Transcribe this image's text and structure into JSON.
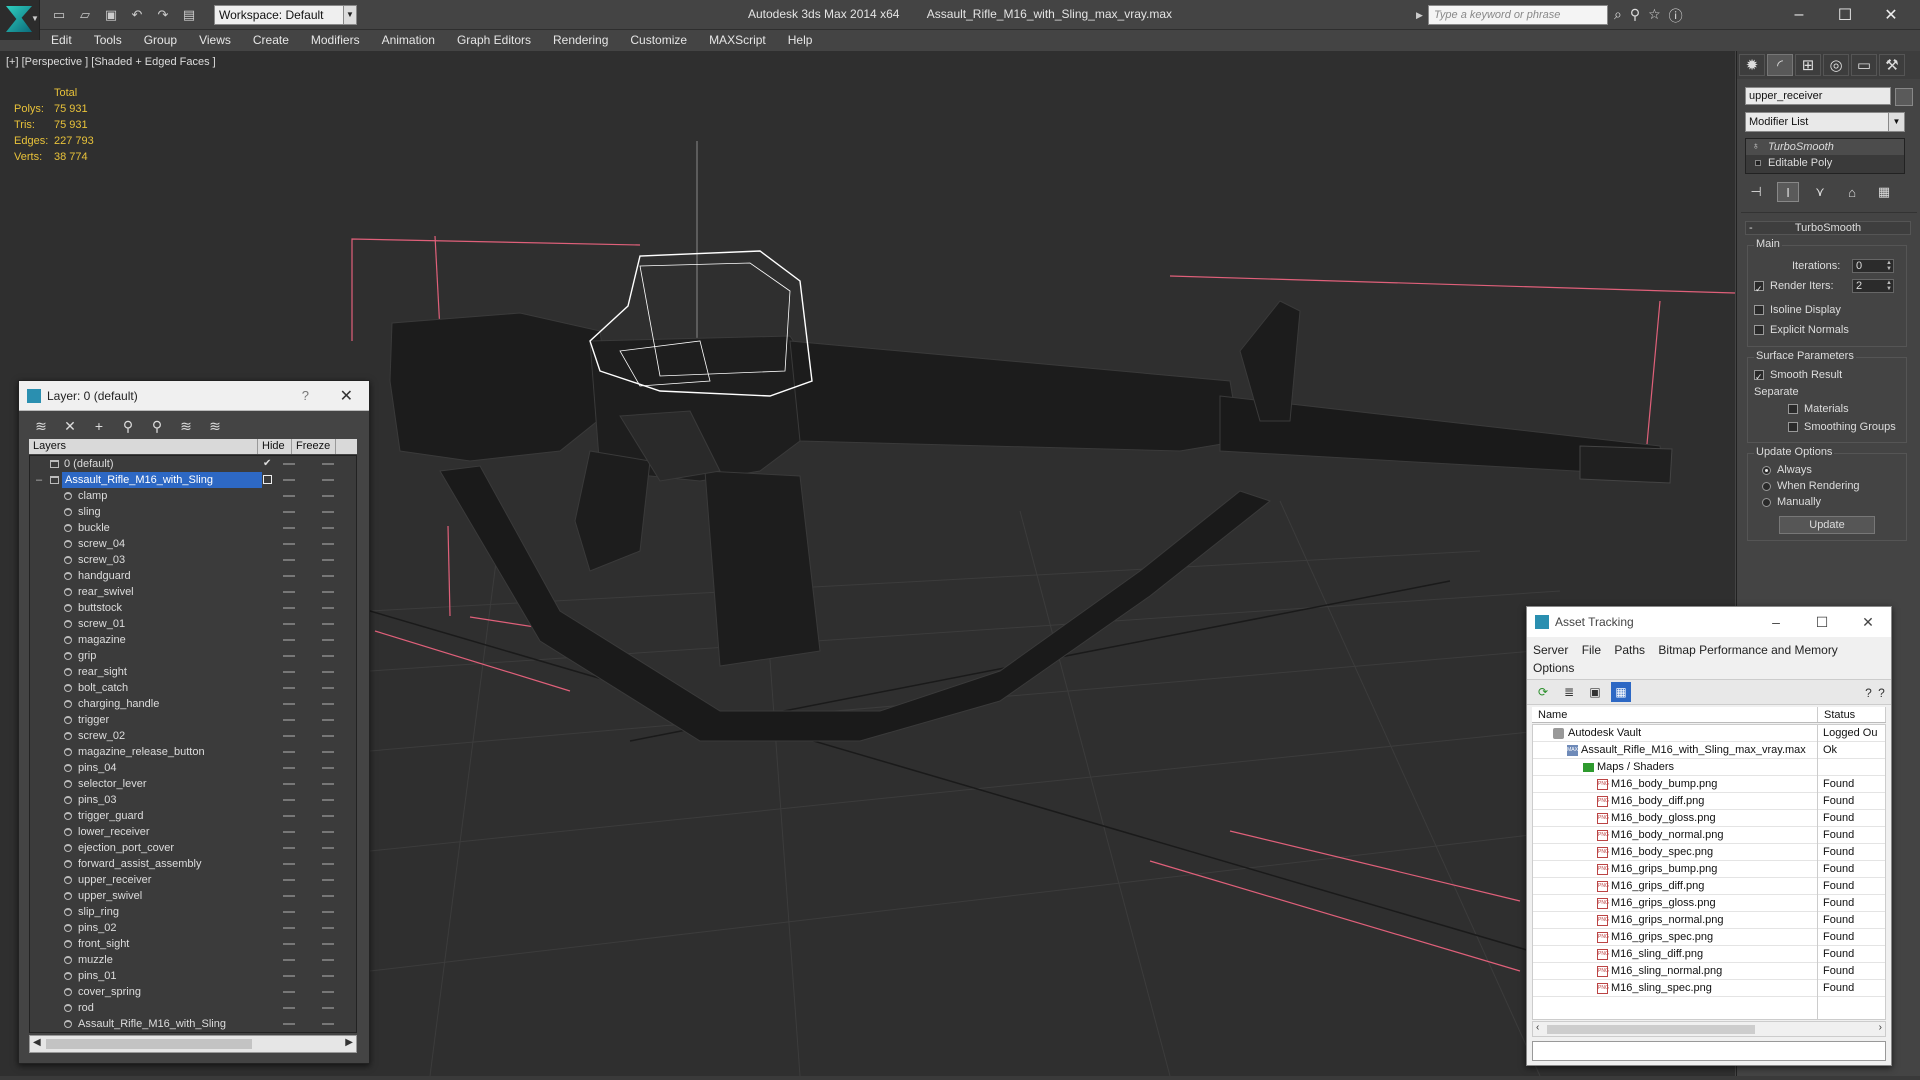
{
  "app": {
    "title": "Autodesk 3ds Max  2014 x64",
    "file": "Assault_Rifle_M16_with_Sling_max_vray.max",
    "workspace": "Workspace: Default",
    "search_placeholder": "Type a keyword or phrase"
  },
  "menu": [
    "Edit",
    "Tools",
    "Group",
    "Views",
    "Create",
    "Modifiers",
    "Animation",
    "Graph Editors",
    "Rendering",
    "Customize",
    "MAXScript",
    "Help"
  ],
  "viewport": {
    "label": "[+] [Perspective ] [Shaded + Edged Faces ]",
    "stats": {
      "header": "Total",
      "rows": [
        {
          "label": "Polys:",
          "value": "75 931"
        },
        {
          "label": "Tris:",
          "value": "75 931"
        },
        {
          "label": "Edges:",
          "value": "227 793"
        },
        {
          "label": "Verts:",
          "value": "38 774"
        }
      ]
    }
  },
  "command_panel": {
    "object_name": "upper_receiver",
    "modifier_list": "Modifier List",
    "stack": [
      "TurboSmooth",
      "Editable Poly"
    ],
    "rollout_title": "TurboSmooth",
    "main_group": "Main",
    "iterations_label": "Iterations:",
    "iterations_value": "0",
    "render_iters_label": "Render Iters:",
    "render_iters_value": "2",
    "isoline": "Isoline Display",
    "explicit_normals": "Explicit Normals",
    "surface_group": "Surface Parameters",
    "smooth_result": "Smooth Result",
    "separate": "Separate",
    "materials": "Materials",
    "smoothing_groups": "Smoothing Groups",
    "update_group": "Update Options",
    "always": "Always",
    "when_rendering": "When Rendering",
    "manually": "Manually",
    "update_button": "Update"
  },
  "layer_window": {
    "title": "Layer: 0 (default)",
    "help": "?",
    "col_layers": "Layers",
    "col_hide": "Hide",
    "col_freeze": "Freeze",
    "default_layer": "0 (default)",
    "selected_layer": "Assault_Rifle_M16_with_Sling",
    "objects": [
      "clamp",
      "sling",
      "buckle",
      "screw_04",
      "screw_03",
      "handguard",
      "rear_swivel",
      "buttstock",
      "screw_01",
      "magazine",
      "grip",
      "rear_sight",
      "bolt_catch",
      "charging_handle",
      "trigger",
      "screw_02",
      "magazine_release_button",
      "pins_04",
      "selector_lever",
      "pins_03",
      "trigger_guard",
      "lower_receiver",
      "ejection_port_cover",
      "forward_assist_assembly",
      "upper_receiver",
      "upper_swivel",
      "slip_ring",
      "pins_02",
      "front_sight",
      "muzzle",
      "pins_01",
      "cover_spring",
      "rod",
      "Assault_Rifle_M16_with_Sling"
    ]
  },
  "asset_window": {
    "title": "Asset Tracking",
    "menu": [
      "Server",
      "File",
      "Paths",
      "Bitmap Performance and Memory",
      "Options"
    ],
    "col_name": "Name",
    "col_status": "Status",
    "vault": {
      "name": "Autodesk Vault",
      "status": "Logged Ou"
    },
    "scene": {
      "name": "Assault_Rifle_M16_with_Sling_max_vray.max",
      "status": "Ok"
    },
    "maps": {
      "name": "Maps / Shaders",
      "status": ""
    },
    "files": [
      {
        "name": "M16_body_bump.png",
        "status": "Found"
      },
      {
        "name": "M16_body_diff.png",
        "status": "Found"
      },
      {
        "name": "M16_body_gloss.png",
        "status": "Found"
      },
      {
        "name": "M16_body_normal.png",
        "status": "Found"
      },
      {
        "name": "M16_body_spec.png",
        "status": "Found"
      },
      {
        "name": "M16_grips_bump.png",
        "status": "Found"
      },
      {
        "name": "M16_grips_diff.png",
        "status": "Found"
      },
      {
        "name": "M16_grips_gloss.png",
        "status": "Found"
      },
      {
        "name": "M16_grips_normal.png",
        "status": "Found"
      },
      {
        "name": "M16_grips_spec.png",
        "status": "Found"
      },
      {
        "name": "M16_sling_diff.png",
        "status": "Found"
      },
      {
        "name": "M16_sling_normal.png",
        "status": "Found"
      },
      {
        "name": "M16_sling_spec.png",
        "status": "Found"
      }
    ]
  },
  "colors": {
    "stats": "#e8c23a",
    "selection": "#2d68c4",
    "bbox": "#e0607a",
    "selected_wire": "#ffffff"
  },
  "icons": {
    "logo": "3ds-max-logo",
    "qat": [
      "new-icon",
      "open-icon",
      "save-icon",
      "undo-icon",
      "redo-icon",
      "project-icon"
    ],
    "info": [
      "binoculars-icon",
      "search-icon",
      "star-icon",
      "help-icon"
    ]
  }
}
